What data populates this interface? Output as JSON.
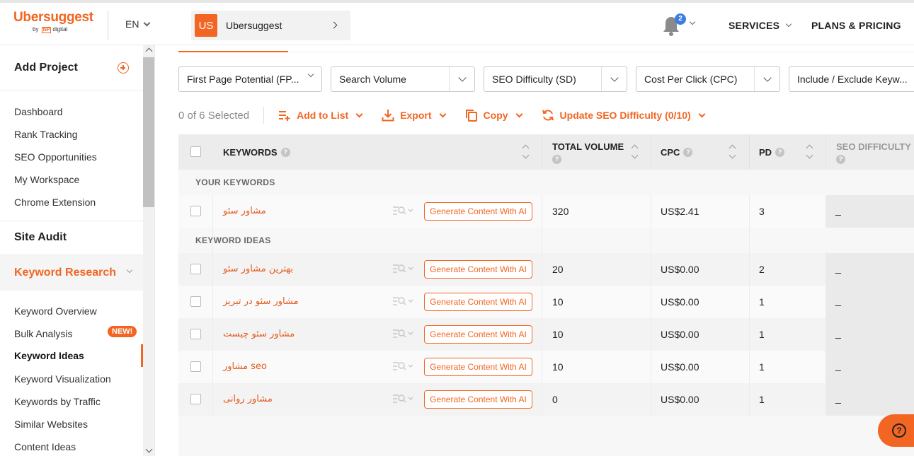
{
  "header": {
    "logo_name": "Ubersuggest",
    "logo_by": "by",
    "logo_np": "NP",
    "logo_digital": "digital",
    "language": "EN",
    "project_badge": "US",
    "project_name": "Ubersuggest",
    "notification_count": "2",
    "services_label": "SERVICES",
    "plans_label": "PLANS & PRICING"
  },
  "sidebar": {
    "add_project": "Add Project",
    "menu": [
      "Dashboard",
      "Rank Tracking",
      "SEO Opportunities",
      "My Workspace",
      "Chrome Extension"
    ],
    "site_audit": "Site Audit",
    "keyword_research": "Keyword Research",
    "kr_items": [
      "Keyword Overview",
      "Bulk Analysis",
      "Keyword Ideas",
      "Keyword Visualization",
      "Keywords by Traffic",
      "Similar Websites",
      "Content Ideas"
    ],
    "new_badge": "NEW!",
    "active_item": "Keyword Ideas"
  },
  "filters": [
    "First Page Potential (FP...",
    "Search Volume",
    "SEO Difficulty (SD)",
    "Cost Per Click (CPC)",
    "Include / Exclude Keyw..."
  ],
  "actions": {
    "selected": "0 of 6 Selected",
    "add_to_list": "Add to List",
    "export": "Export",
    "copy": "Copy",
    "update_sd": "Update SEO Difficulty (0/10)"
  },
  "table": {
    "headers": {
      "keywords": "KEYWORDS",
      "total_volume": "TOTAL VOLUME",
      "cpc": "CPC",
      "pd": "PD",
      "seo_difficulty": "SEO DIFFICULTY"
    },
    "groups": {
      "yours": "YOUR KEYWORDS",
      "ideas": "KEYWORD IDEAS"
    },
    "generate_label": "Generate Content With AI",
    "your_keywords": [
      {
        "keyword": "مشاور سئو",
        "volume": "320",
        "cpc": "US$2.41",
        "pd": "3",
        "sd": "_"
      }
    ],
    "keyword_ideas": [
      {
        "keyword": "بهترین مشاور سئو",
        "volume": "20",
        "cpc": "US$0.00",
        "pd": "2",
        "sd": "_"
      },
      {
        "keyword": "مشاور سئو در تبریز",
        "volume": "10",
        "cpc": "US$0.00",
        "pd": "1",
        "sd": "_"
      },
      {
        "keyword": "مشاور سئو چیست",
        "volume": "10",
        "cpc": "US$0.00",
        "pd": "1",
        "sd": "_"
      },
      {
        "keyword": "مشاور seo",
        "volume": "10",
        "cpc": "US$0.00",
        "pd": "1",
        "sd": "_"
      },
      {
        "keyword": "مشاور روانی",
        "volume": "0",
        "cpc": "US$0.00",
        "pd": "1",
        "sd": "_"
      }
    ]
  },
  "colors": {
    "accent": "#f26522",
    "notification": "#3d7de0"
  }
}
